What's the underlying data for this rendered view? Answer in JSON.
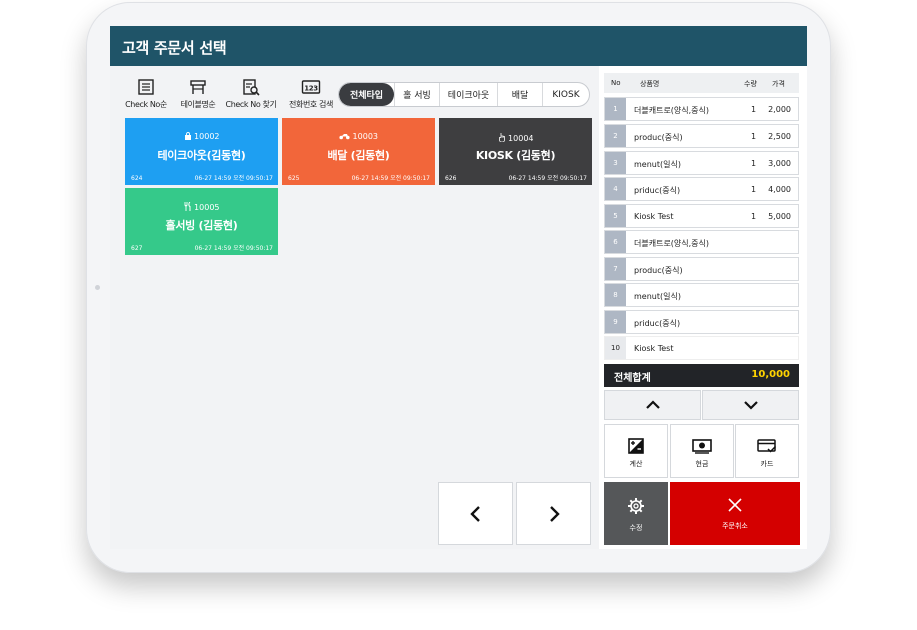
{
  "window": {
    "title": "고객 주문서 선택"
  },
  "toolbar": [
    {
      "label": "Check No순",
      "icon": "list-icon"
    },
    {
      "label": "테이블명순",
      "icon": "table-icon"
    },
    {
      "label": "Check No 찾기",
      "icon": "document-search-icon"
    },
    {
      "label": "전화번호 검색",
      "icon": "phone-number-icon",
      "icon_text": "123"
    }
  ],
  "filters": {
    "items": [
      "전체타입",
      "홀 서빙",
      "테이크아웃",
      "배달",
      "KIOSK"
    ],
    "selected": "전체타입"
  },
  "orders": [
    {
      "number": "10002",
      "name": "테이크아웃(김동현)",
      "id": "624",
      "time": "06-27 14:59 오전 09:50:17",
      "color": "#1e9ff2",
      "icon": "bag-icon"
    },
    {
      "number": "10003",
      "name": "배달 (김동현)",
      "id": "625",
      "time": "06-27 14:59 오전 09:50:17",
      "color": "#f2663a",
      "icon": "motorbike-icon"
    },
    {
      "number": "10004",
      "name": "KIOSK (김동현)",
      "id": "626",
      "time": "06-27 14:59 오전 09:50:17",
      "color": "#3e3e40",
      "icon": "touch-icon"
    },
    {
      "number": "10005",
      "name": "홀서빙 (김동현)",
      "id": "627",
      "time": "06-27 14:59 오전 09:50:17",
      "color": "#35c98a",
      "icon": "utensils-icon"
    }
  ],
  "order_table": {
    "headers": {
      "no": "No",
      "name": "상품명",
      "qty": "수량",
      "price": "가격"
    },
    "rows": [
      {
        "no": "1",
        "name": "더블캐트로(양식,중식)",
        "qty": "1",
        "price": "2,000"
      },
      {
        "no": "2",
        "name": "produc(중식)",
        "qty": "1",
        "price": "2,500"
      },
      {
        "no": "3",
        "name": "menut(일식)",
        "qty": "1",
        "price": "3,000"
      },
      {
        "no": "4",
        "name": "priduc(중식)",
        "qty": "1",
        "price": "4,000"
      },
      {
        "no": "5",
        "name": "Kiosk Test",
        "qty": "1",
        "price": "5,000"
      },
      {
        "no": "6",
        "name": "더블캐트로(양식,중식)",
        "qty": "",
        "price": ""
      },
      {
        "no": "7",
        "name": "produc(중식)",
        "qty": "",
        "price": ""
      },
      {
        "no": "8",
        "name": "menut(일식)",
        "qty": "",
        "price": ""
      },
      {
        "no": "9",
        "name": "priduc(중식)",
        "qty": "",
        "price": ""
      },
      {
        "no": "10",
        "name": "Kiosk Test",
        "qty": "",
        "price": ""
      }
    ]
  },
  "total": {
    "label": "전체합계",
    "value": "10,000"
  },
  "actions": {
    "calc": "계산",
    "cash": "현금",
    "card": "카드",
    "edit": "수정",
    "cancel": "주문취소"
  },
  "colors": {
    "header": "#1f5468",
    "cancel": "#d40000",
    "edit": "#555759",
    "total_value": "#ffd400"
  }
}
